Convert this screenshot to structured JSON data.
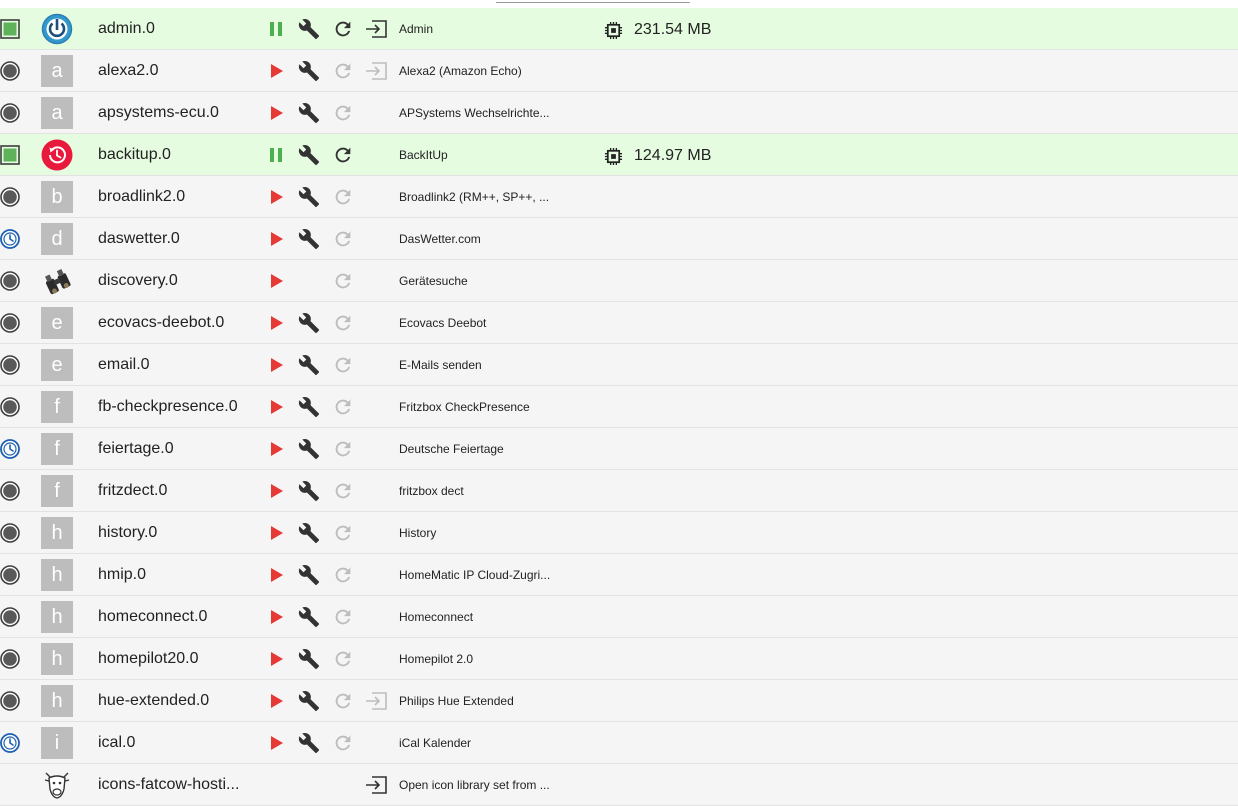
{
  "colors": {
    "running_row": "#e5fce0",
    "row": "#f5f5f5",
    "running_status": "#5fb25a",
    "stopped_status": "#595959",
    "schedule_status": "#1e61b0",
    "start_button": "#e53935",
    "pause_button": "#4caf50",
    "disabled_icon": "#bdbdbd"
  },
  "adapters": [
    {
      "name": "admin.0",
      "title": "Admin",
      "status": "running",
      "icon": "admin-logo-icon",
      "memory": "231.54 MB",
      "run": "pause",
      "settings": true,
      "restart": "active",
      "open": "active"
    },
    {
      "name": "alexa2.0",
      "title": "Alexa2 (Amazon Echo)",
      "status": "stopped",
      "icon_letter": "a",
      "run": "start",
      "settings": true,
      "restart": "disabled",
      "open": "disabled"
    },
    {
      "name": "apsystems-ecu.0",
      "title": "APSystems Wechselrichte...",
      "status": "stopped",
      "icon_letter": "a",
      "run": "start",
      "settings": true,
      "restart": "disabled",
      "open": "none"
    },
    {
      "name": "backitup.0",
      "title": "BackItUp",
      "status": "running",
      "icon": "backitup-logo-icon",
      "memory": "124.97 MB",
      "run": "pause",
      "settings": true,
      "restart": "active",
      "open": "none"
    },
    {
      "name": "broadlink2.0",
      "title": "Broadlink2 (RM++, SP++, ...",
      "status": "stopped",
      "icon_letter": "b",
      "run": "start",
      "settings": true,
      "restart": "disabled",
      "open": "none"
    },
    {
      "name": "daswetter.0",
      "title": "DasWetter.com",
      "status": "schedule",
      "icon_letter": "d",
      "run": "start",
      "settings": true,
      "restart": "disabled",
      "open": "none"
    },
    {
      "name": "discovery.0",
      "title": "Gerätesuche",
      "status": "stopped",
      "icon": "binoculars-icon",
      "run": "start",
      "settings": false,
      "restart": "disabled",
      "open": "none"
    },
    {
      "name": "ecovacs-deebot.0",
      "title": "Ecovacs Deebot",
      "status": "stopped",
      "icon_letter": "e",
      "run": "start",
      "settings": true,
      "restart": "disabled",
      "open": "none"
    },
    {
      "name": "email.0",
      "title": "E-Mails senden",
      "status": "stopped",
      "icon_letter": "e",
      "run": "start",
      "settings": true,
      "restart": "disabled",
      "open": "none"
    },
    {
      "name": "fb-checkpresence.0",
      "title": "Fritzbox CheckPresence",
      "status": "stopped",
      "icon_letter": "f",
      "run": "start",
      "settings": true,
      "restart": "disabled",
      "open": "none"
    },
    {
      "name": "feiertage.0",
      "title": "Deutsche Feiertage",
      "status": "schedule",
      "icon_letter": "f",
      "run": "start",
      "settings": true,
      "restart": "disabled",
      "open": "none"
    },
    {
      "name": "fritzdect.0",
      "title": "fritzbox dect",
      "status": "stopped",
      "icon_letter": "f",
      "run": "start",
      "settings": true,
      "restart": "disabled",
      "open": "none"
    },
    {
      "name": "history.0",
      "title": "History",
      "status": "stopped",
      "icon_letter": "h",
      "run": "start",
      "settings": true,
      "restart": "disabled",
      "open": "none"
    },
    {
      "name": "hmip.0",
      "title": "HomeMatic IP Cloud-Zugri...",
      "status": "stopped",
      "icon_letter": "h",
      "run": "start",
      "settings": true,
      "restart": "disabled",
      "open": "none"
    },
    {
      "name": "homeconnect.0",
      "title": "Homeconnect",
      "status": "stopped",
      "icon_letter": "h",
      "run": "start",
      "settings": true,
      "restart": "disabled",
      "open": "none"
    },
    {
      "name": "homepilot20.0",
      "title": "Homepilot 2.0",
      "status": "stopped",
      "icon_letter": "h",
      "run": "start",
      "settings": true,
      "restart": "disabled",
      "open": "none"
    },
    {
      "name": "hue-extended.0",
      "title": "Philips Hue Extended",
      "status": "stopped",
      "icon_letter": "h",
      "run": "start",
      "settings": true,
      "restart": "disabled",
      "open": "disabled"
    },
    {
      "name": "ical.0",
      "title": "iCal Kalender",
      "status": "schedule",
      "icon_letter": "i",
      "run": "start",
      "settings": true,
      "restart": "disabled",
      "open": "none"
    },
    {
      "name": "icons-fatcow-hosti...",
      "title": "Open icon library set from ...",
      "status": "none",
      "icon": "cow-logo-icon",
      "run": "none",
      "settings": false,
      "restart": "none",
      "open": "active"
    }
  ]
}
